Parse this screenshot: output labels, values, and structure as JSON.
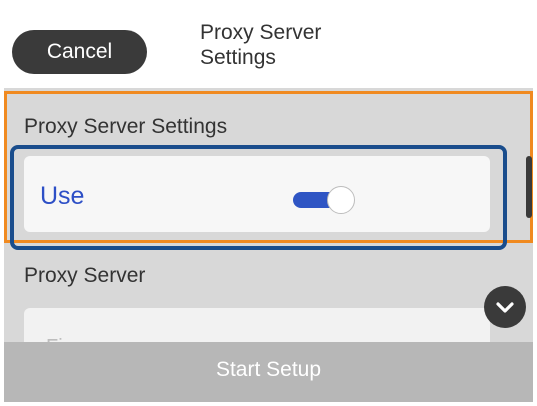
{
  "header": {
    "cancel_label": "Cancel",
    "title": "Proxy Server\nSettings"
  },
  "sections": {
    "proxy_settings_label": "Proxy Server Settings",
    "use_label": "Use",
    "use_enabled": true,
    "proxy_server_label": "Proxy Server",
    "proxy_server_value_partial": "Fi..."
  },
  "footer": {
    "start_setup_label": "Start Setup"
  },
  "icons": {
    "scroll_down": "chevron-down-icon"
  },
  "colors": {
    "header_bg": "#ffffff",
    "cancel_bg": "#3a3a3a",
    "selection_orange": "#f08a20",
    "highlight_blue": "#1a4d8c",
    "toggle_on": "#2f55c4",
    "use_text": "#2d4fc6",
    "footer_bg": "#b7b7b7"
  }
}
